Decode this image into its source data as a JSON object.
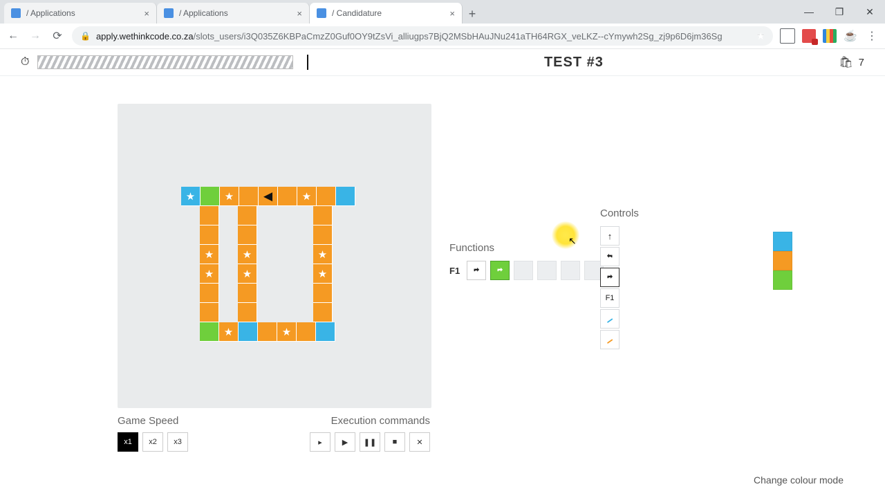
{
  "browser": {
    "tabs": [
      {
        "title": "/ Applications",
        "active": false
      },
      {
        "title": "/ Applications",
        "active": false
      },
      {
        "title": "/ Candidature",
        "active": true
      }
    ],
    "url_host": "apply.wethinkcode.co.za",
    "url_path": "/slots_users/i3Q035Z6KBPaCmzZ0Guf0OY9tZsVi_alliugps7BjQ2MSbHAuJNu241aTH64RGX_veLKZ--cYmywh2Sg_zj9p6D6jm36Sg",
    "url_full": "https://apply.wethinkcode.co.za/slots_users/i3Q035Z6KBPaCmzZ0Guf0OY9tZsVi_alliugps7BjQ2MSbHAuJNu241aTH64RGX_veLKZ--cYmywh2Sg_zj9p6D6jm36Sg"
  },
  "header": {
    "title": "TEST #3",
    "cart_count": "7"
  },
  "board": {
    "legend": {
      "b": "blue",
      "o": "orange",
      "g": "green",
      "e": "empty",
      "star": "collectible",
      "ship": "player-facing-left"
    },
    "grid": [
      [
        "b*",
        "g",
        "o*",
        "o",
        "o!",
        "o",
        "o*",
        "o",
        "b"
      ],
      [
        "e",
        "o",
        "e",
        "o",
        "e",
        "e",
        "e",
        "o",
        "e"
      ],
      [
        "e",
        "o",
        "e",
        "o",
        "e",
        "e",
        "e",
        "o",
        "e"
      ],
      [
        "e",
        "o*",
        "e",
        "o*",
        "e",
        "e",
        "e",
        "o*",
        "e"
      ],
      [
        "e",
        "o*",
        "e",
        "o*",
        "e",
        "e",
        "e",
        "o*",
        "e"
      ],
      [
        "e",
        "o",
        "e",
        "o",
        "e",
        "e",
        "e",
        "o",
        "e"
      ],
      [
        "e",
        "o",
        "e",
        "o",
        "e",
        "e",
        "e",
        "o",
        "e"
      ],
      [
        "e",
        "g",
        "o*",
        "b",
        "o",
        "o*",
        "o",
        "b",
        "e"
      ]
    ],
    "note": "'*' suffix = star, '!' suffix = player ship, row 0 is top"
  },
  "game_speed": {
    "label": "Game Speed",
    "options": [
      "x1",
      "x2",
      "x3"
    ],
    "selected": "x1"
  },
  "execution": {
    "label": "Execution commands",
    "buttons": [
      "step",
      "play",
      "pause",
      "stop",
      "clear"
    ]
  },
  "functions": {
    "label": "Functions",
    "rows": [
      {
        "name": "F1",
        "slots": [
          {
            "action": "turn-right",
            "color": null
          },
          {
            "action": "turn-right",
            "color": "green"
          },
          {
            "action": null
          },
          {
            "action": null
          },
          {
            "action": null
          },
          {
            "action": null
          }
        ]
      }
    ]
  },
  "controls": {
    "label": "Controls",
    "tools": [
      "forward",
      "turn-left",
      "turn-right",
      "F1",
      "paint-blue",
      "paint-orange"
    ],
    "selected": "turn-right",
    "colors": [
      "blue",
      "orange",
      "green"
    ],
    "f1_label": "F1"
  },
  "footer": {
    "colour_mode": "Change colour mode"
  }
}
